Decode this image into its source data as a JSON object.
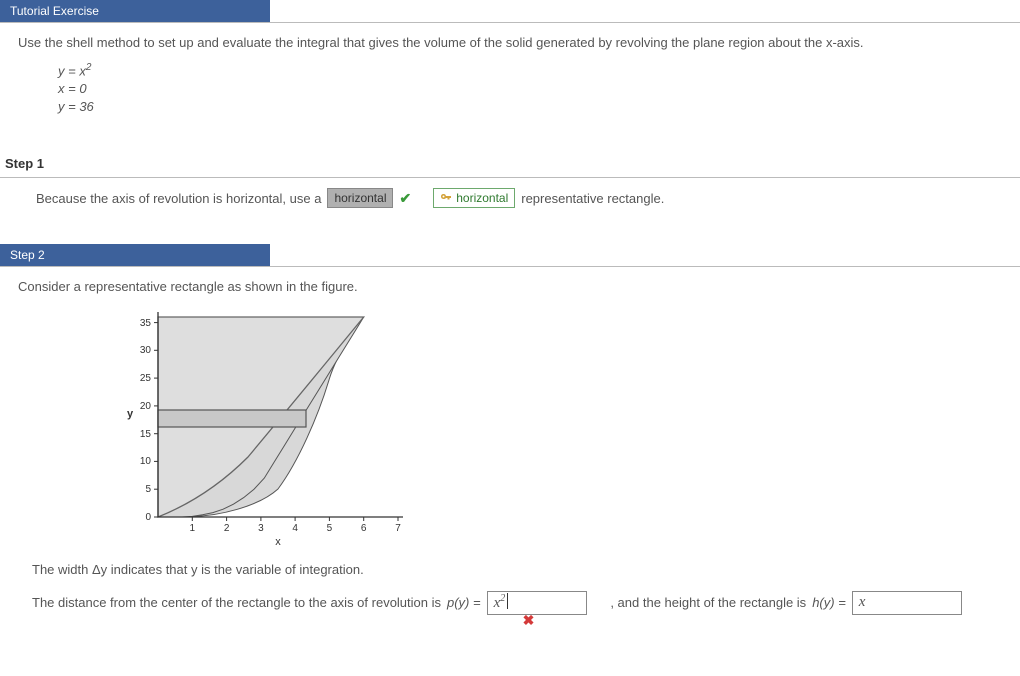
{
  "tutorial_banner": "Tutorial Exercise",
  "prompt": "Use the shell method to set up and evaluate the integral that gives the volume of the solid generated by revolving the plane region about the x-axis.",
  "eq1_lhs": "y = x",
  "eq1_sup": "2",
  "eq2": "x = 0",
  "eq3": "y = 36",
  "step1_label": "Step 1",
  "step1_text_a": "Because the axis of revolution is horizontal, use a",
  "step1_grey": "horizontal",
  "step1_green": "horizontal",
  "step1_text_b": "representative rectangle.",
  "step2_banner": "Step 2",
  "step2_text": "Consider a representative rectangle as shown in the figure.",
  "widthy_text": "The width  Δy  indicates that y is the variable of integration.",
  "ans_a": "The distance from the center of the rectangle to the axis of revolution is ",
  "py_label": "p(y) = ",
  "py_val": "x²",
  "ans_b": ",  and the height of the rectangle is ",
  "hy_label": "h(y) = ",
  "hy_val": "x",
  "chart_data": {
    "type": "area",
    "title": "",
    "xlabel": "x",
    "ylabel": "y",
    "xlim": [
      0,
      7
    ],
    "ylim": [
      0,
      36
    ],
    "x_ticks": [
      1,
      2,
      3,
      4,
      5,
      6,
      7
    ],
    "y_ticks": [
      0,
      5,
      10,
      15,
      20,
      25,
      30,
      35
    ],
    "curve": "y = x^2",
    "region_bounds": {
      "left": "x=0",
      "top": "y=36",
      "right": "y=x^2"
    },
    "representative_rectangle": {
      "y_center": 18,
      "width_x": 4.2,
      "dy": 3
    }
  }
}
